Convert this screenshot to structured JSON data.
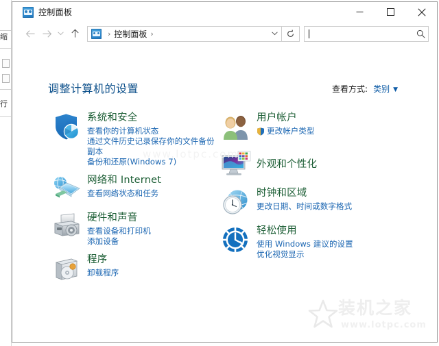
{
  "window": {
    "title": "控制面板",
    "title_icon": "control-panel-icon",
    "controls": {
      "minimize": "minimize-icon",
      "maximize": "maximize-icon",
      "close": "close-icon"
    }
  },
  "navbar": {
    "back": "back-arrow-icon",
    "forward": "forward-arrow-icon",
    "recent": "chevron-down-icon",
    "up": "up-arrow-icon",
    "breadcrumb": {
      "icon": "control-panel-icon",
      "separator": "›",
      "items": [
        "控制面板"
      ],
      "trailing_separator": "›"
    },
    "address_dropdown": "chevron-down-icon",
    "refresh": "refresh-icon",
    "search": {
      "value": "",
      "placeholder": "",
      "icon": "search-icon"
    }
  },
  "content": {
    "page_title": "调整计算机的设置",
    "view_by": {
      "label": "查看方式:",
      "value": "类别",
      "arrow": "▼"
    },
    "left_column": [
      {
        "icon": "shield-security-icon",
        "title": "系统和安全",
        "links": [
          {
            "text": "查看你的计算机状态",
            "shield": false
          },
          {
            "text": "通过文件历史记录保存你的文件备份副本",
            "shield": false
          },
          {
            "text": "备份和还原(Windows 7)",
            "shield": false
          }
        ]
      },
      {
        "icon": "network-internet-icon",
        "title": "网络和 Internet",
        "links": [
          {
            "text": "查看网络状态和任务",
            "shield": false
          }
        ]
      },
      {
        "icon": "hardware-sound-icon",
        "title": "硬件和声音",
        "links": [
          {
            "text": "查看设备和打印机",
            "shield": false
          },
          {
            "text": "添加设备",
            "shield": false
          }
        ]
      },
      {
        "icon": "programs-icon",
        "title": "程序",
        "links": [
          {
            "text": "卸载程序",
            "shield": false
          }
        ]
      }
    ],
    "right_column": [
      {
        "icon": "user-accounts-icon",
        "title": "用户帐户",
        "links": [
          {
            "text": "更改帐户类型",
            "shield": true
          }
        ]
      },
      {
        "icon": "appearance-personalization-icon",
        "title": "外观和个性化",
        "links": []
      },
      {
        "icon": "clock-region-icon",
        "title": "时钟和区域",
        "links": [
          {
            "text": "更改日期、时间或数字格式",
            "shield": false
          }
        ]
      },
      {
        "icon": "ease-of-access-icon",
        "title": "轻松使用",
        "links": [
          {
            "text": "使用 Windows 建议的设置",
            "shield": false
          },
          {
            "text": "优化视觉显示",
            "shield": false
          }
        ]
      }
    ]
  },
  "watermark": {
    "name": "装机之家",
    "url": "www.lotpc.com",
    "logo": "star-logo-icon"
  },
  "colors": {
    "category_title": "#1c5e35",
    "category_link": "#1b66b2",
    "page_title": "#0b4f8a",
    "view_by_value": "#0d5ba6",
    "window_border": "#9a9a9a"
  }
}
